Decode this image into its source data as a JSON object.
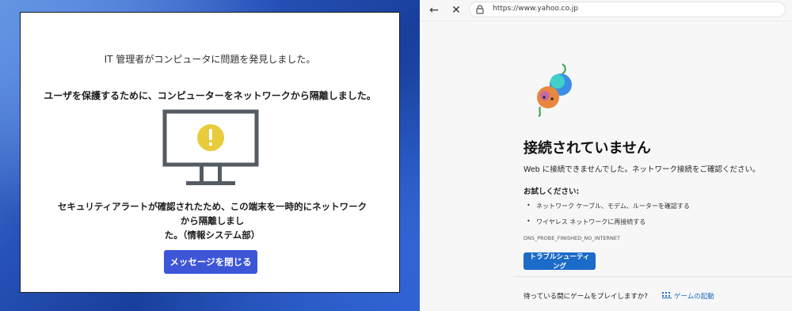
{
  "colors": {
    "dialog_button": "#3d56d8",
    "warning_yellow": "#e8cc3c",
    "monitor_stroke": "#545b63",
    "browser_accent": "#1b6bc8"
  },
  "dialog": {
    "title": "IT 管理者がコンピュータに問題を発見しました。",
    "heading": "ユーザを保護するために、コンピューターをネットワークから隔離しました。",
    "body_line1": "セキュリティアラートが確認されたため、この端末を一時的にネットワークから隔離しまし",
    "body_line2": "た。（情報システム部）",
    "close_button": "メッセージを閉じる",
    "icon": "warning-monitor-icon"
  },
  "browser": {
    "url": "https://www.yahoo.co.jp",
    "error_title": "接続されていません",
    "error_desc": "Web に接続できませんでした。ネットワーク接続をご確認ください。",
    "try_label": "お試しください:",
    "suggestions": [
      "ネットワーク ケーブル、モデム、ルーターを確認する",
      "ワイヤレス ネットワークに再接続する"
    ],
    "error_code": "DNS_PROBE_FINISHED_NO_INTERNET",
    "troubleshoot_button": "トラブルシューティング",
    "game_question": "待っている間にゲームをプレイしますか?",
    "game_link": "ゲームの起動"
  }
}
